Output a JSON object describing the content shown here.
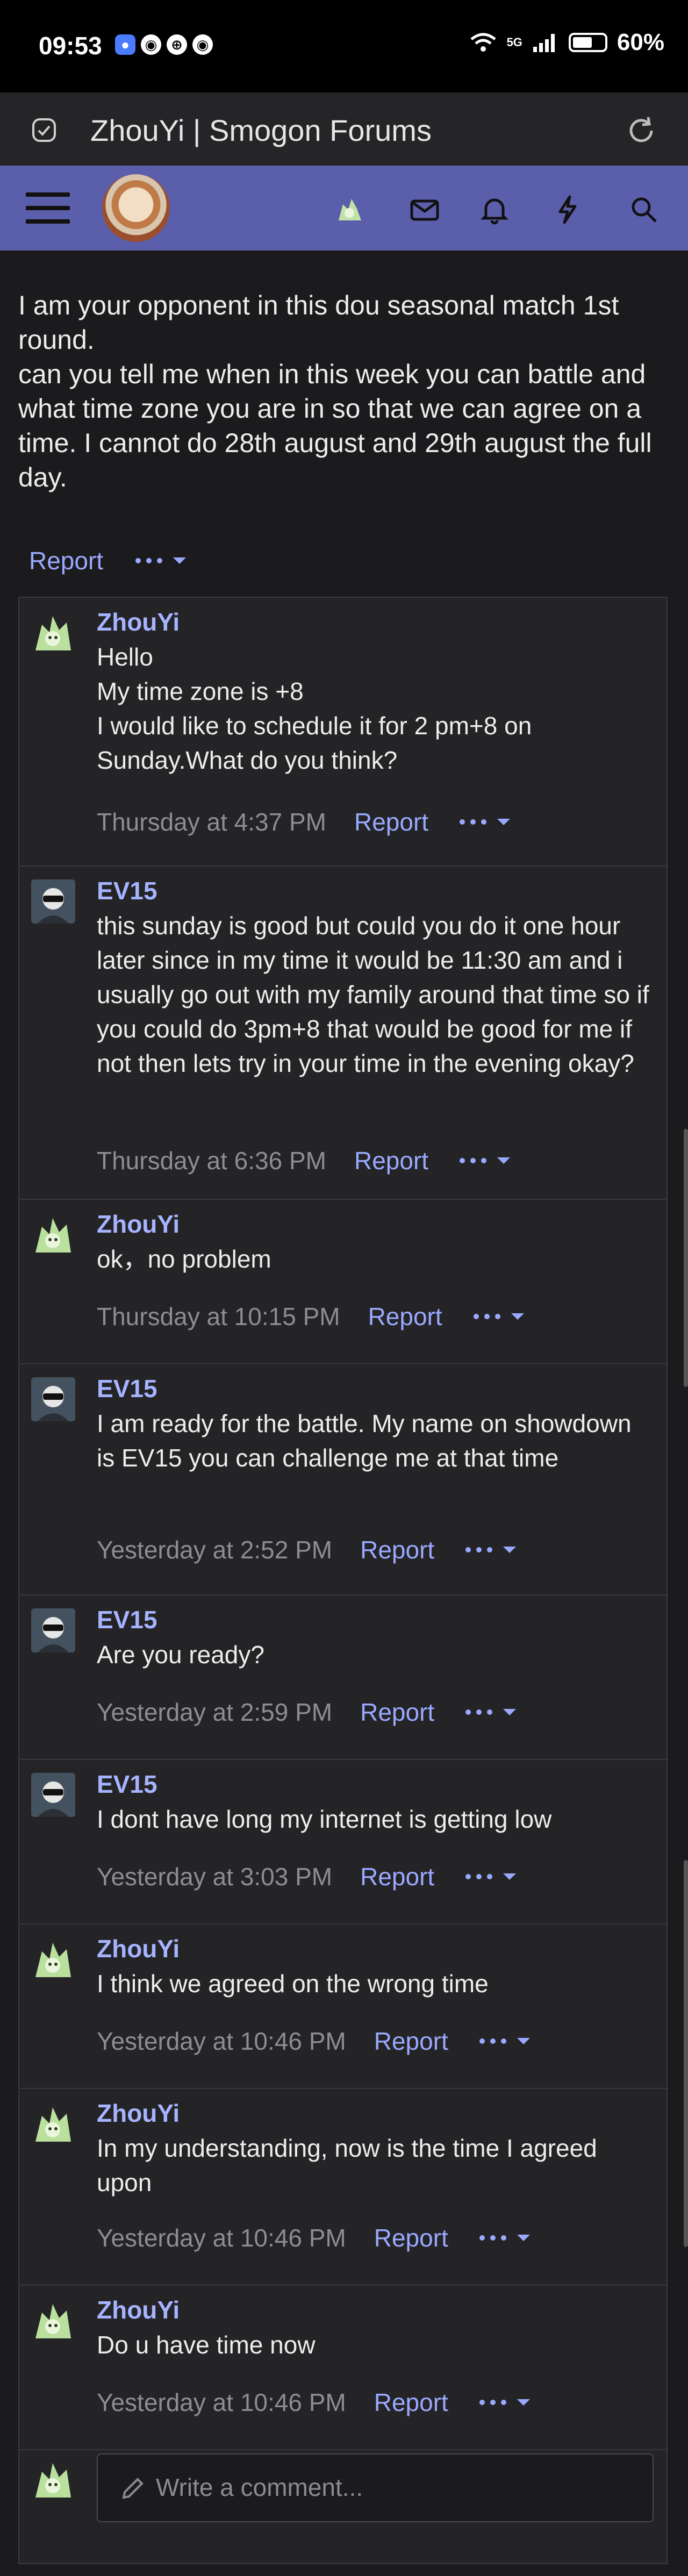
{
  "status": {
    "time": "09:53",
    "battery": "60%",
    "network": "5G"
  },
  "browser": {
    "title": "ZhouYi | Smogon Forums"
  },
  "op": {
    "lines": [
      "I am your opponent in this dou seasonal match 1st round.",
      "can you tell me when in this week you can battle and what time zone you are in so that we can agree on a time. I cannot do 28th august and 29th august the full day."
    ],
    "report": "Report"
  },
  "comments": [
    {
      "author": "ZhouYi",
      "body": "Hello\nMy time zone is +8\nI would like to schedule it for 2 pm+8 on Sunday.What do you think?",
      "time": "Thursday at 4:37 PM",
      "report": "Report"
    },
    {
      "author": "EV15",
      "body": "this sunday is good but could you do it one hour later since in my time it would be 11:30 am and i usually go out with my family around that time so if you could do 3pm+8 that would be good for me if not then lets try in your time in the evening okay?",
      "time": "Thursday at 6:36 PM",
      "report": "Report"
    },
    {
      "author": "ZhouYi",
      "body": "ok，no problem",
      "time": "Thursday at 10:15 PM",
      "report": "Report"
    },
    {
      "author": "EV15",
      "body": "I am ready for the battle. My name on showdown is EV15 you can challenge me at that time",
      "time": "Yesterday at 2:52 PM",
      "report": "Report"
    },
    {
      "author": "EV15",
      "body": "Are you ready?",
      "time": "Yesterday at 2:59 PM",
      "report": "Report"
    },
    {
      "author": "EV15",
      "body": "I dont have long my internet is getting low",
      "time": "Yesterday at 3:03 PM",
      "report": "Report"
    },
    {
      "author": "ZhouYi",
      "body": "I think we agreed on the wrong time",
      "time": "Yesterday at 10:46 PM",
      "report": "Report"
    },
    {
      "author": "ZhouYi",
      "body": "In my understanding, now is the time I agreed upon",
      "time": "Yesterday at 10:46 PM",
      "report": "Report"
    },
    {
      "author": "ZhouYi",
      "body": "Do u have time now",
      "time": "Yesterday at 10:46 PM",
      "report": "Report"
    }
  ],
  "write": {
    "placeholder": "Write a comment..."
  }
}
